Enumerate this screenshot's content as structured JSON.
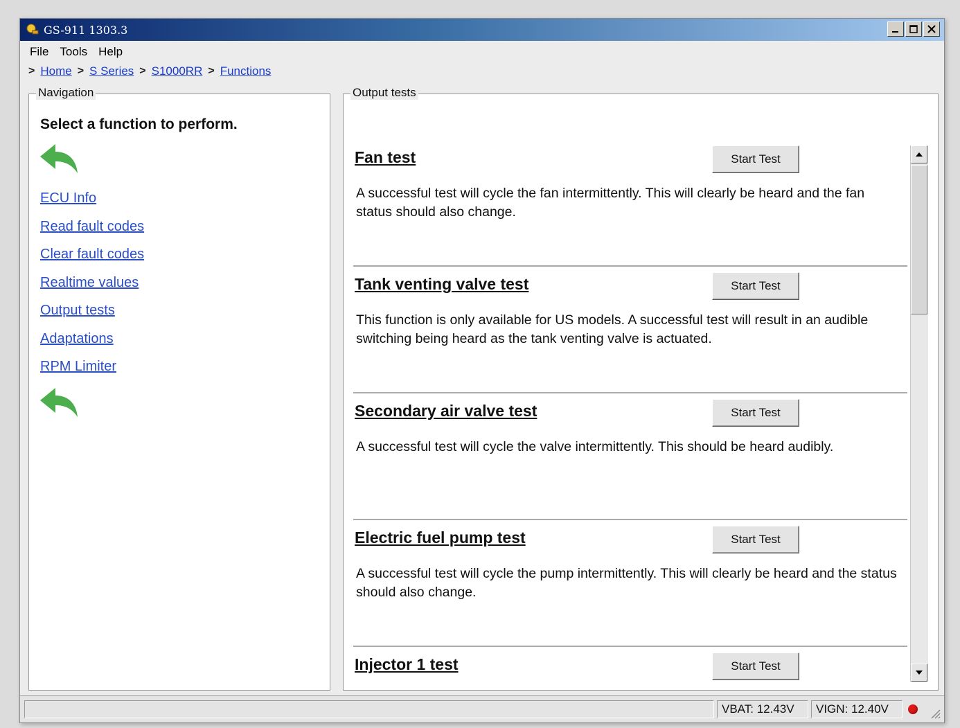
{
  "window": {
    "title": "GS-911 1303.3"
  },
  "menu": [
    "File",
    "Tools",
    "Help"
  ],
  "breadcrumb": [
    "Home",
    "S Series",
    "S1000RR",
    "Functions"
  ],
  "navigation": {
    "group_title": "Navigation",
    "heading": "Select a function to perform.",
    "links": [
      "ECU Info",
      "Read fault codes",
      "Clear fault codes",
      "Realtime values",
      "Output tests",
      "Adaptations",
      "RPM Limiter"
    ]
  },
  "output_tests": {
    "group_title": "Output tests",
    "button_label": "Start Test",
    "items": [
      {
        "title": "Fan test",
        "description": "A successful test will cycle the fan intermittently. This will clearly be heard and the fan status should also change."
      },
      {
        "title": "Tank venting valve test",
        "description": "This function is only available for US models. A successful test will result in an audible switching being heard as the tank venting valve is actuated."
      },
      {
        "title": "Secondary air valve test",
        "description": "A successful test will cycle the valve intermittently. This should be heard audibly."
      },
      {
        "title": "Electric fuel pump test",
        "description": "A successful test will cycle the pump intermittently. This will clearly be heard and the status should also change."
      },
      {
        "title": "Injector 1 test",
        "description": ""
      }
    ]
  },
  "status": {
    "vbat": "VBAT: 12.43V",
    "vign": "VIGN: 12.40V"
  },
  "colors": {
    "back_arrow": "#4cae4c",
    "link": "#2a4ec8",
    "status_led": "#e01818"
  },
  "icons": {
    "back": "back-arrow-icon",
    "app": "app-icon"
  }
}
